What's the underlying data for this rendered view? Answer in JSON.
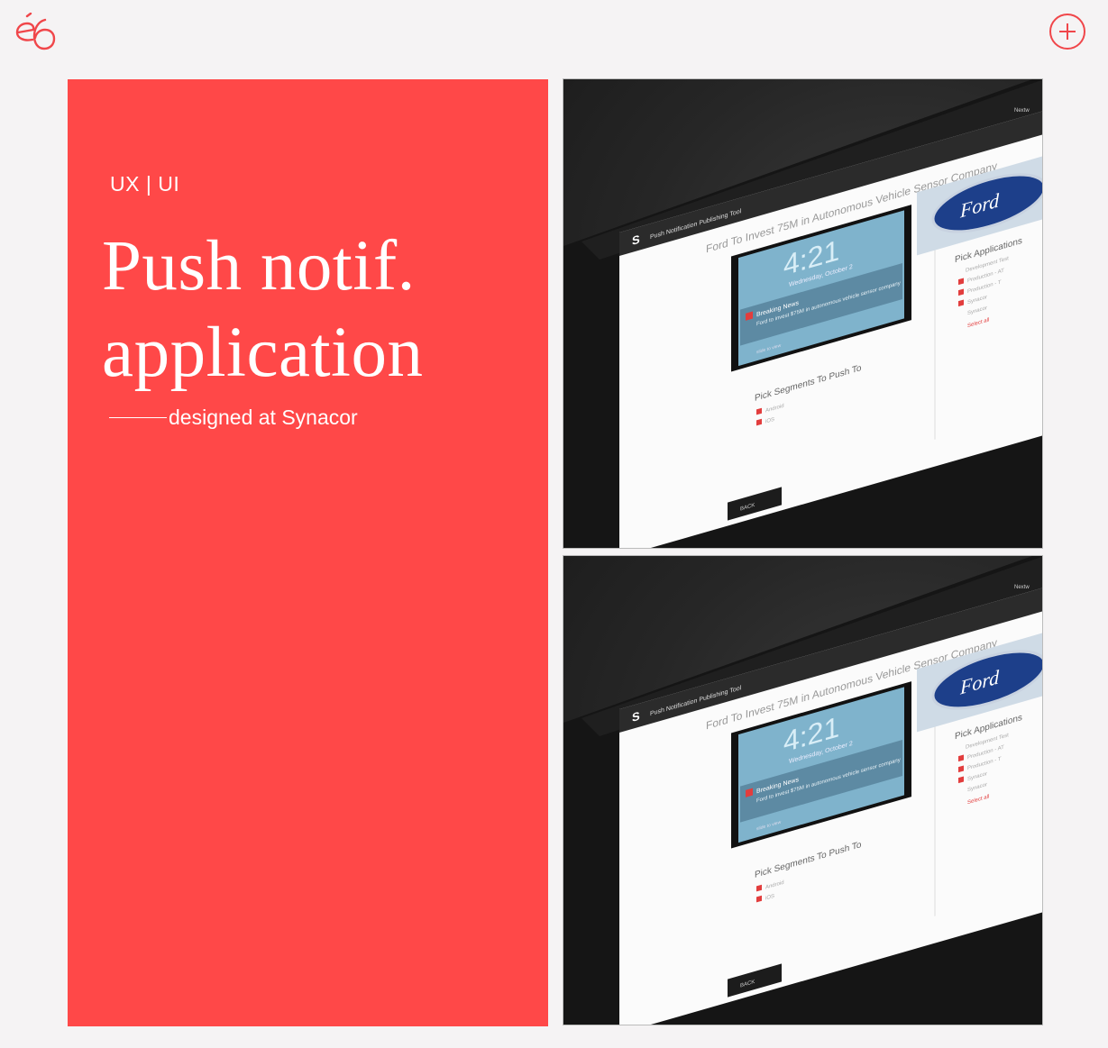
{
  "header": {
    "logo_icon": "e6-logo",
    "menu_icon": "plus-circle-icon"
  },
  "hero": {
    "category": "UX | UI",
    "title_line1": "Push notif.",
    "title_line2": "application",
    "byline": "designed at Synacor"
  },
  "tablet": {
    "app_title": "Push Notification Publishing Tool",
    "headline": "Ford To Invest 75M in Autonomous Vehicle Sensor Company",
    "clock": "4:21",
    "date": "Wednesday, October 2",
    "notification_title": "Breaking News",
    "notification_time": "now",
    "notification_body": "Ford to invest $75M in autonomous vehicle sensor company",
    "slide_hint": "slide to view",
    "segments_heading": "Pick Segments To Push To",
    "segments": [
      "Android",
      "iOS"
    ],
    "applications_heading": "Pick Applications",
    "applications": [
      "Development Test",
      "Production - AT",
      "Production - T",
      "Synacor",
      "Synacor"
    ],
    "select_all": "Select all",
    "back_label": "BACK",
    "nav_label": "Nextw",
    "brand_logo_text": "Ford"
  },
  "colors": {
    "accent": "#ff4848",
    "background": "#f5f3f4"
  }
}
